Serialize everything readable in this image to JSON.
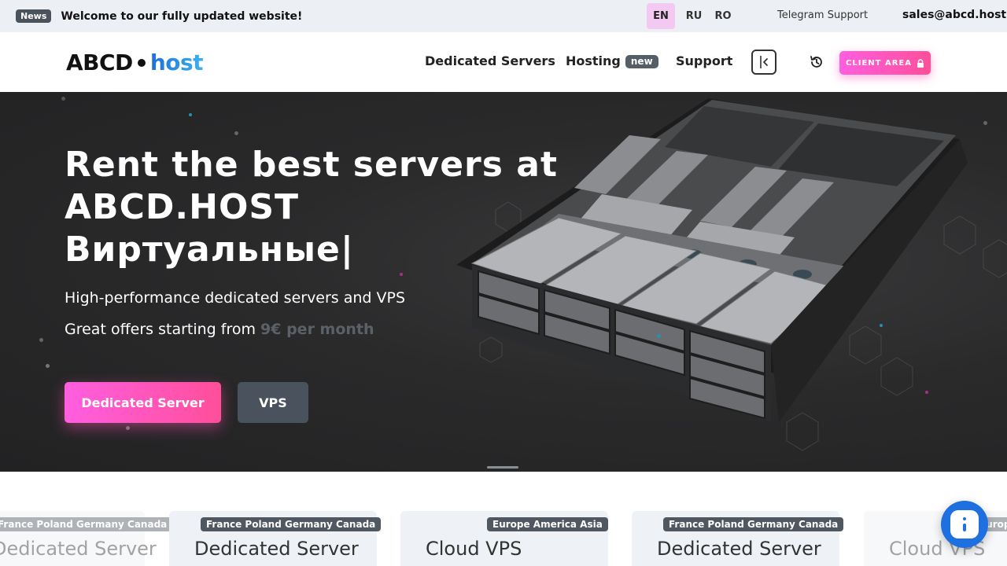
{
  "topbar": {
    "news_badge": "News",
    "news_text": "Welcome to our fully updated website!",
    "languages": [
      {
        "code": "EN",
        "active": true
      },
      {
        "code": "RU",
        "active": false
      },
      {
        "code": "RO",
        "active": false
      }
    ],
    "telegram": "Telegram Support",
    "email": "sales@abcd.host"
  },
  "header": {
    "logo_left": "ABCD",
    "logo_right": "host",
    "nav": {
      "dedicated": "Dedicated Servers",
      "hosting": "Hosting",
      "hosting_badge": "new",
      "support": "Support"
    },
    "client_area": "CLIENT AREA"
  },
  "hero": {
    "title_line1": "Rent the best servers at",
    "title_line2": "ABCD.HOST",
    "title_line3": "Виртуальные|",
    "subtitle": "High-performance dedicated servers and VPS",
    "offer_prefix": "Great offers starting from",
    "offer_price": "9€ per month",
    "btn_dedicated": "Dedicated Server",
    "btn_vps": "VPS"
  },
  "cards": [
    {
      "tag": "France Poland Germany Canada",
      "title": "Dedicated Server",
      "faded": true
    },
    {
      "tag": "France Poland Germany Canada",
      "title": "Dedicated Server",
      "faded": false
    },
    {
      "tag": "Europe America Asia",
      "title": "Cloud VPS",
      "faded": false
    },
    {
      "tag": "France Poland Germany Canada",
      "title": "Dedicated Server",
      "faded": false
    },
    {
      "tag": "Europe America Asia",
      "title": "Cloud VPS",
      "faded": true
    }
  ],
  "colors": {
    "accent_pink": "#ff5ee0",
    "accent_pink_end": "#ff4f9a",
    "hero_bg": "#2a2a2b",
    "chat_blue": "#1e6fe0"
  },
  "icons": [
    "collapse-icon",
    "history-icon",
    "lock-icon",
    "chat-icon"
  ]
}
